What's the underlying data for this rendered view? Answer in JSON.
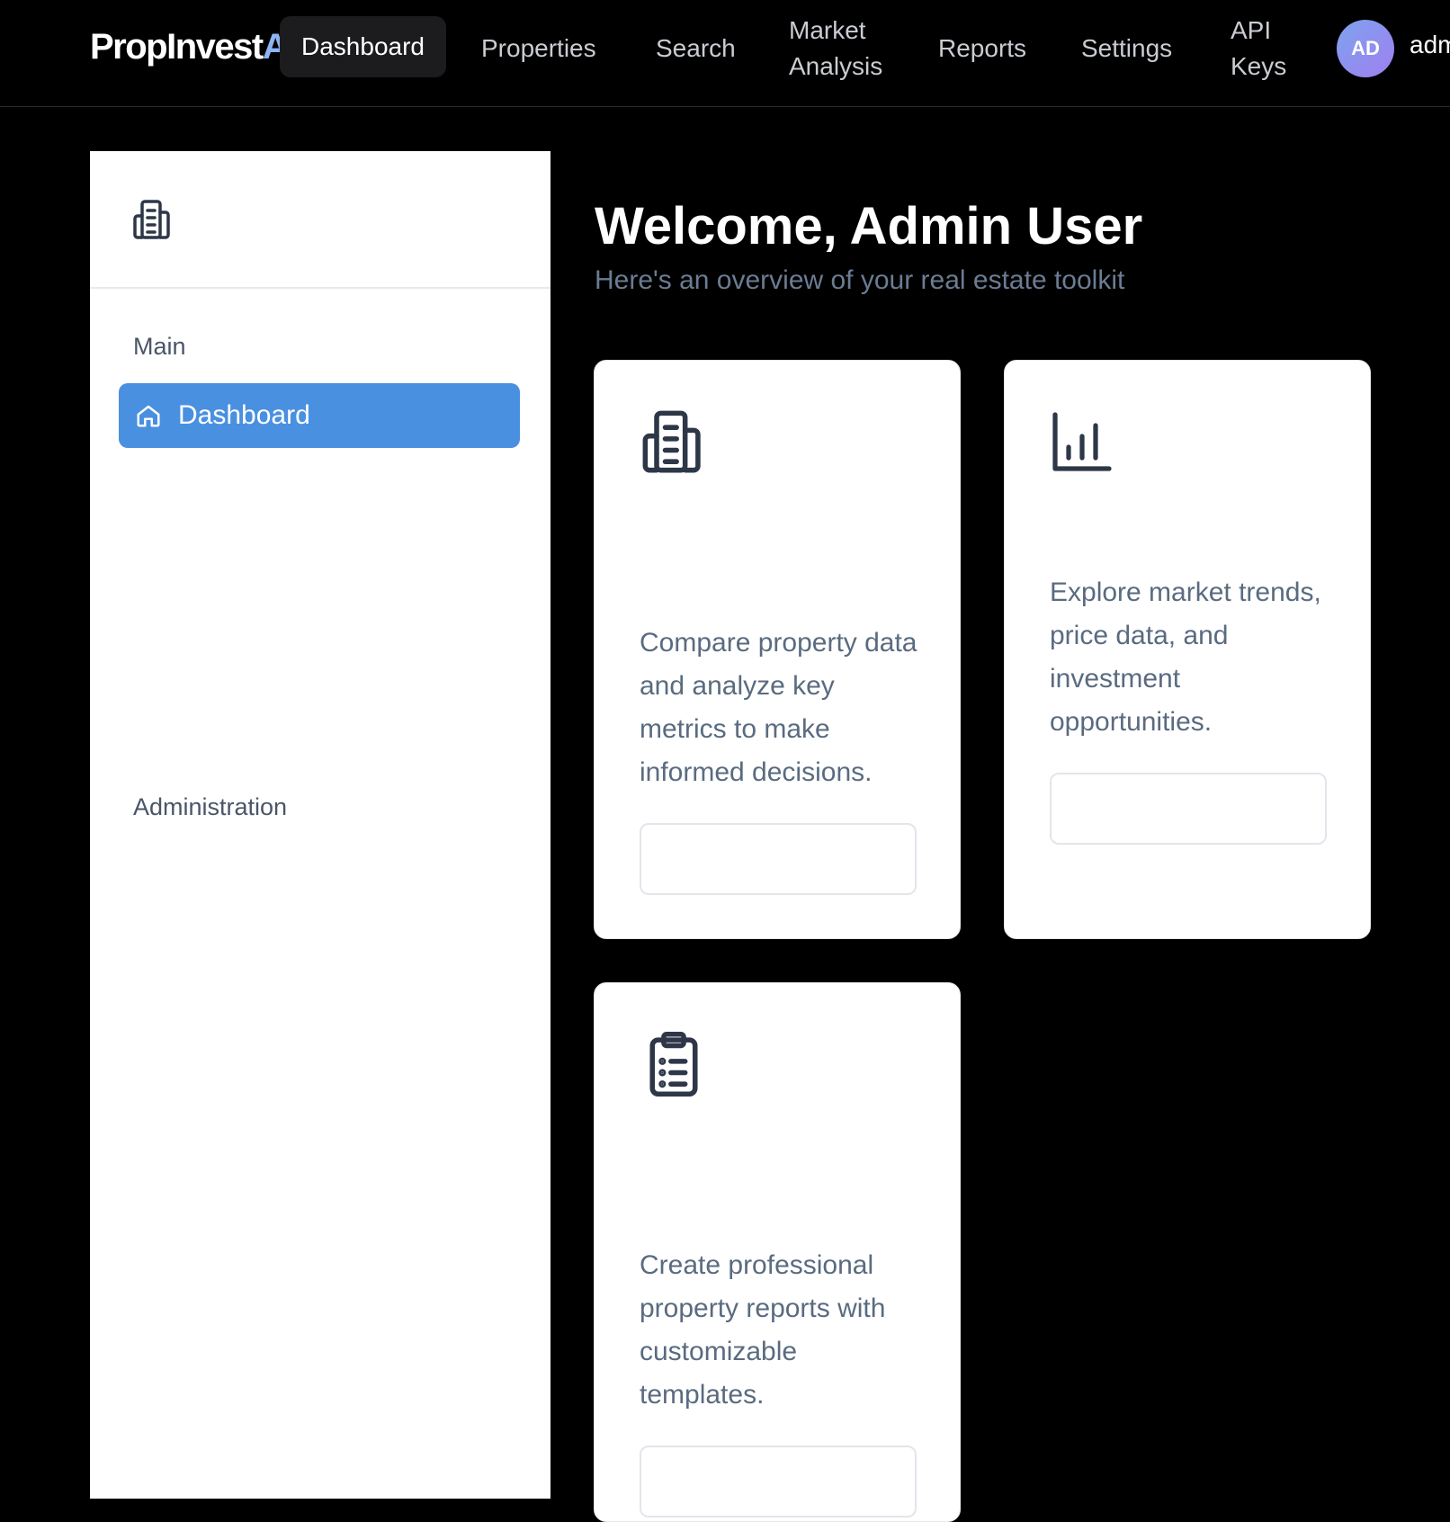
{
  "app": {
    "brand_main": "PropInvest",
    "brand_accent": "AI"
  },
  "topnav": {
    "items": [
      {
        "label": "Dashboard",
        "active": true
      },
      {
        "label": "Properties"
      },
      {
        "label": "Search"
      },
      {
        "label": "Market Analysis"
      },
      {
        "label": "Reports"
      },
      {
        "label": "Settings"
      },
      {
        "label": "API Keys"
      }
    ],
    "avatar_initials": "AD",
    "username": "adm"
  },
  "sidebar": {
    "logo_icon": "building-icon",
    "sections": [
      {
        "label": "Main",
        "items": [
          {
            "label": "Dashboard",
            "icon": "home-icon",
            "active": true
          }
        ]
      },
      {
        "label": "Administration",
        "items": []
      }
    ]
  },
  "main": {
    "welcome": "Welcome, Admin User",
    "subtitle": "Here's an overview of your real estate toolkit",
    "cards": [
      {
        "icon": "building-icon",
        "description": "Compare property data and analyze key metrics to make informed decisions.",
        "button_label": ""
      },
      {
        "icon": "bar-chart-icon",
        "description": "Explore market trends, price data, and investment opportunities.",
        "button_label": ""
      },
      {
        "icon": "clipboard-list-icon",
        "description": "Create professional property reports with customizable templates.",
        "button_label": ""
      }
    ]
  },
  "colors": {
    "accent": "#4a90e0",
    "background": "#000000",
    "text_muted": "#5a6b80",
    "avatar_gradient_start": "#7da3ee",
    "avatar_gradient_end": "#a07ff0"
  }
}
